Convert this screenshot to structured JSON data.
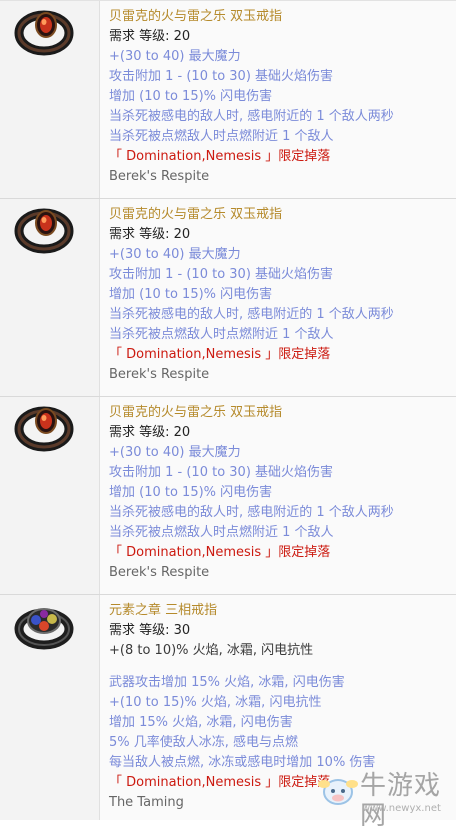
{
  "items": [
    {
      "icon": "ring-icon",
      "name": "贝雷克的火与雷之乐 双玉戒指",
      "requirement": "需求 等级: 20",
      "mods": [
        "+(30 to 40) 最大魔力",
        "攻击附加 1 - (10 to 30) 基础火焰伤害",
        "增加 (10 to 15)% 闪电伤害",
        "当杀死被感电的敌人时, 感电附近的 1 个敌人两秒",
        "当杀死被点燃敌人时点燃附近 1 个敌人"
      ],
      "source": "「 Domination,Nemesis 」限定掉落",
      "english_name": "Berek's Respite"
    },
    {
      "icon": "ring-icon",
      "name": "贝雷克的火与雷之乐 双玉戒指",
      "requirement": "需求 等级: 20",
      "mods": [
        "+(30 to 40) 最大魔力",
        "攻击附加 1 - (10 to 30) 基础火焰伤害",
        "增加 (10 to 15)% 闪电伤害",
        "当杀死被感电的敌人时, 感电附近的 1 个敌人两秒",
        "当杀死被点燃敌人时点燃附近 1 个敌人"
      ],
      "source": "「 Domination,Nemesis 」限定掉落",
      "english_name": "Berek's Respite"
    },
    {
      "icon": "ring-icon",
      "name": "贝雷克的火与雷之乐 双玉戒指",
      "requirement": "需求 等级: 20",
      "mods": [
        "+(30 to 40) 最大魔力",
        "攻击附加 1 - (10 to 30) 基础火焰伤害",
        "增加 (10 to 15)% 闪电伤害",
        "当杀死被感电的敌人时, 感电附近的 1 个敌人两秒",
        "当杀死被点燃敌人时点燃附近 1 个敌人"
      ],
      "source": "「 Domination,Nemesis 」限定掉落",
      "english_name": "Berek's Respite"
    },
    {
      "icon": "tri-gem-ring-icon",
      "name": "元素之章 三相戒指",
      "requirement": "需求 等级: 30",
      "implicit": "+(8 to 10)% 火焰, 冰霜, 闪电抗性",
      "mods": [
        "武器攻击增加 15% 火焰, 冰霜, 闪电伤害",
        "+(10 to 15)% 火焰, 冰霜, 闪电抗性",
        "增加 15% 火焰, 冰霜, 闪电伤害",
        "5% 几率使敌人冰冻, 感电与点燃",
        "每当敌人被点燃, 冰冻或感电时增加 10% 伤害"
      ],
      "source": "「 Domination,Nemesis 」限定掉落",
      "english_name": "The Taming"
    }
  ],
  "watermark": {
    "text": "牛游戏网",
    "url": "www.newyx.net",
    "icon": "cow-mascot-icon"
  }
}
